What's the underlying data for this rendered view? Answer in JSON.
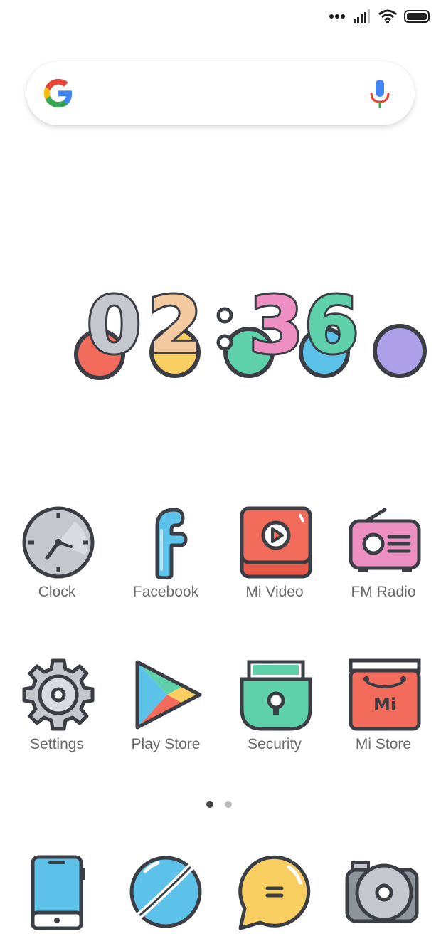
{
  "status_bar": {
    "icons": [
      "more-dots-icon",
      "signal-icon",
      "wifi-icon",
      "battery-icon"
    ]
  },
  "search_bar": {
    "logo": "google-logo",
    "voice_icon": "microphone-icon"
  },
  "clock_widget": {
    "hours": "02",
    "minutes": "36",
    "separator": ":"
  },
  "apps": [
    {
      "label": "Clock",
      "icon": "clock-icon"
    },
    {
      "label": "Facebook",
      "icon": "facebook-icon"
    },
    {
      "label": "Mi Video",
      "icon": "video-play-icon"
    },
    {
      "label": "FM Radio",
      "icon": "radio-icon"
    },
    {
      "label": "Settings",
      "icon": "gear-icon"
    },
    {
      "label": "Play Store",
      "icon": "play-store-icon"
    },
    {
      "label": "Security",
      "icon": "padlock-icon"
    },
    {
      "label": "Mi Store",
      "icon": "shopping-bag-icon",
      "badge": "Mi"
    }
  ],
  "page_indicator": {
    "pages": 2,
    "current": 1
  },
  "dock": [
    {
      "icon": "phone-icon"
    },
    {
      "icon": "browser-globe-icon"
    },
    {
      "icon": "messaging-bubble-icon"
    },
    {
      "icon": "camera-icon"
    }
  ],
  "colors": {
    "outline": "#3b3f45",
    "red": "#f26b5b",
    "blue": "#5cc2ea",
    "green": "#5ed0aa",
    "pink": "#ee8fc4",
    "peach": "#f3c9a0",
    "yellow": "#f9cf62",
    "purple": "#ad9fe8",
    "gray": "#c4c8ce"
  }
}
